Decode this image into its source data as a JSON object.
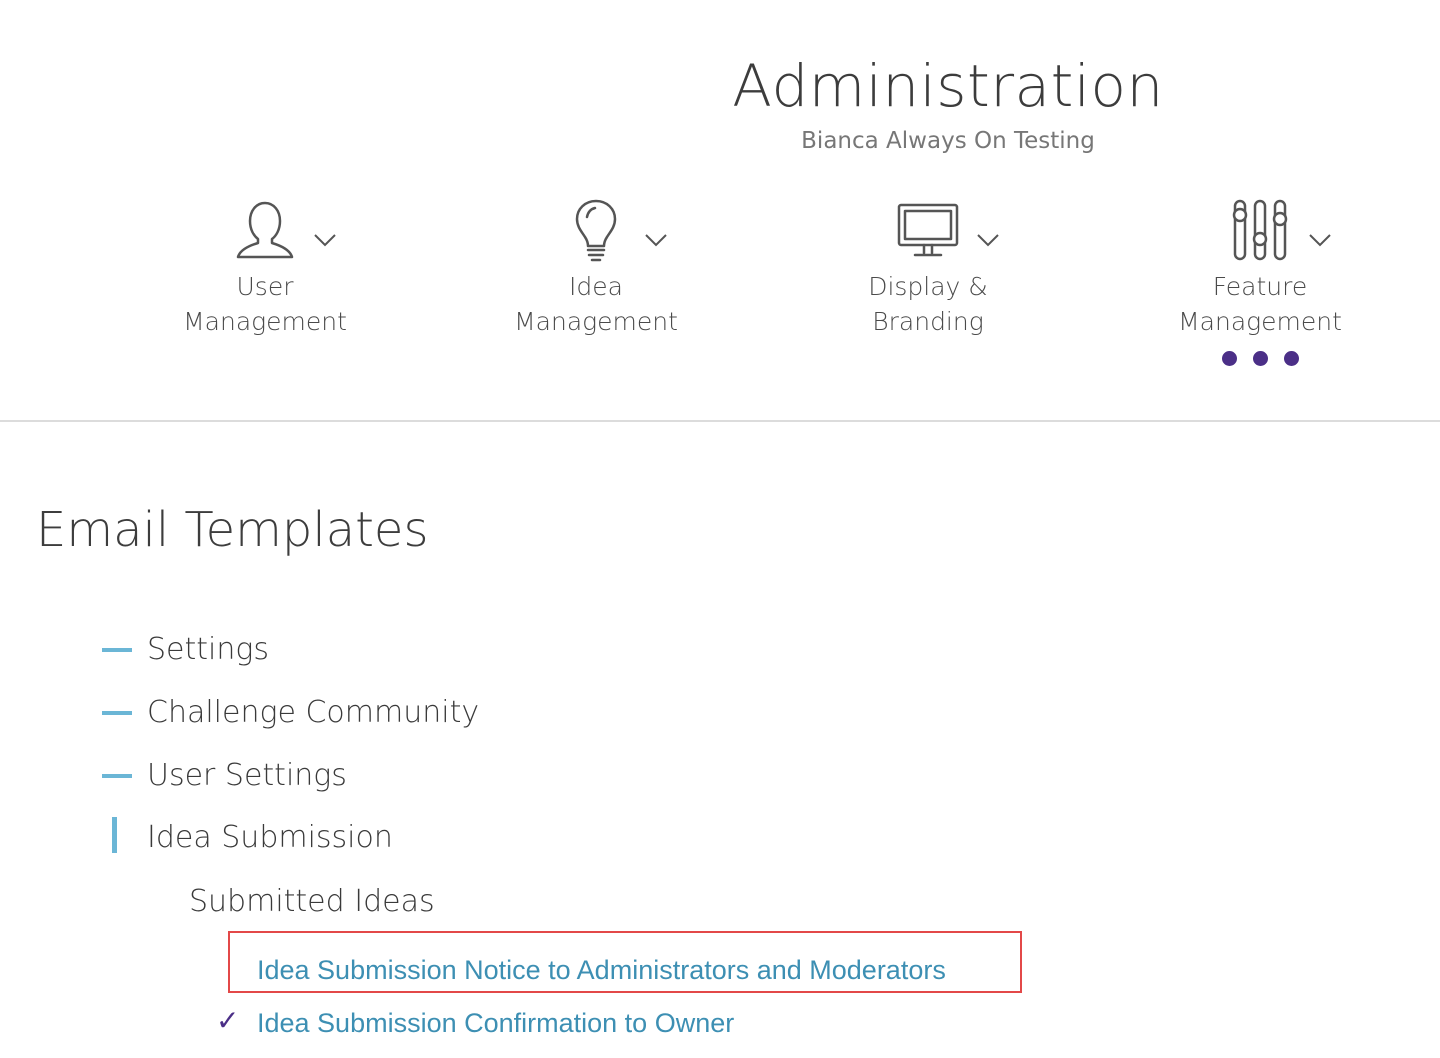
{
  "header": {
    "title": "Administration",
    "subtitle": "Bianca Always On Testing"
  },
  "nav": {
    "items": [
      {
        "icon": "user-icon",
        "line1": "User",
        "line2": "Management"
      },
      {
        "icon": "lightbulb-icon",
        "line1": "Idea",
        "line2": "Management"
      },
      {
        "icon": "monitor-icon",
        "line1": "Display &",
        "line2": "Branding"
      },
      {
        "icon": "sliders-icon",
        "line1": "Feature",
        "line2": "Management",
        "active": true
      }
    ],
    "accent_color": "#4b2f87"
  },
  "section": {
    "title": "Email Templates"
  },
  "tree": {
    "items": [
      {
        "label": "Settings",
        "state": "collapsed"
      },
      {
        "label": "Challenge Community",
        "state": "collapsed"
      },
      {
        "label": "User Settings",
        "state": "collapsed"
      },
      {
        "label": "Idea Submission",
        "state": "expanded"
      }
    ],
    "marker_color": "#6bb6d6",
    "sub_heading": "Submitted Ideas",
    "links": [
      {
        "label": "Idea Submission Notice to Administrators and Moderators",
        "highlighted": true,
        "checked": false
      },
      {
        "label": "Idea Submission Confirmation to Owner",
        "highlighted": false,
        "checked": true
      }
    ],
    "link_color": "#3d8fb3",
    "highlight_color": "#e34848"
  }
}
